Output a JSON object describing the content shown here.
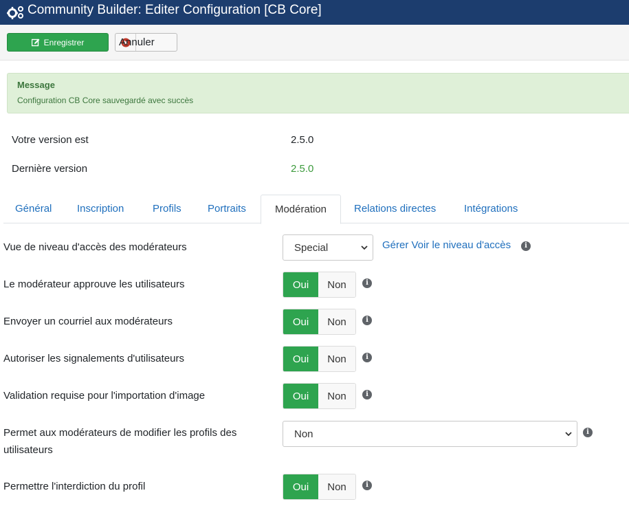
{
  "header": {
    "title": "Community Builder: Editer Configuration [CB Core]"
  },
  "toolbar": {
    "save_label": "Enregistrer",
    "cancel_label": "Annuler"
  },
  "alert": {
    "heading": "Message",
    "text": "Configuration CB Core sauvegardé avec succès"
  },
  "versions": {
    "current_label": "Votre version est",
    "current_value": "2.5.0",
    "latest_label": "Dernière version",
    "latest_value": "2.5.0"
  },
  "tabs": [
    {
      "label": "Général"
    },
    {
      "label": "Inscription"
    },
    {
      "label": "Profils"
    },
    {
      "label": "Portraits"
    },
    {
      "label": "Modération"
    },
    {
      "label": "Relations directes"
    },
    {
      "label": "Intégrations"
    }
  ],
  "active_tab": "Modération",
  "settings": {
    "moderator_access": {
      "label": "Vue de niveau d'accès des modérateurs",
      "value": "Special",
      "link": "Gérer Voir le niveau d'accès"
    },
    "approve_users": {
      "label": "Le modérateur approuve les utilisateurs",
      "on": "Oui",
      "off": "Non",
      "selected": "Oui"
    },
    "email_moderators": {
      "label": "Envoyer un courriel aux modérateurs",
      "on": "Oui",
      "off": "Non",
      "selected": "Oui"
    },
    "allow_reports": {
      "label": "Autoriser les signalements d'utilisateurs",
      "on": "Oui",
      "off": "Non",
      "selected": "Oui"
    },
    "image_validation": {
      "label": "Validation requise pour l'importation d'image",
      "on": "Oui",
      "off": "Non",
      "selected": "Oui"
    },
    "edit_profiles": {
      "label_line1": "Permet aux modérateurs de modifier les profils des",
      "label_line2": "utilisateurs",
      "value": "Non"
    },
    "profile_ban": {
      "label": "Permettre l'interdiction du profil",
      "on": "Oui",
      "off": "Non",
      "selected": "Oui"
    }
  },
  "colors": {
    "header_bg": "#1c3d6e",
    "success": "#2ea44f",
    "link": "#1f6fbd",
    "alert_bg": "#dff0d8",
    "alert_text": "#3c763d",
    "version_latest": "#3c9a3c"
  },
  "icons": {
    "header": "gears-icon",
    "save": "edit-icon",
    "cancel": "close-circle-icon",
    "help": "info-icon"
  }
}
